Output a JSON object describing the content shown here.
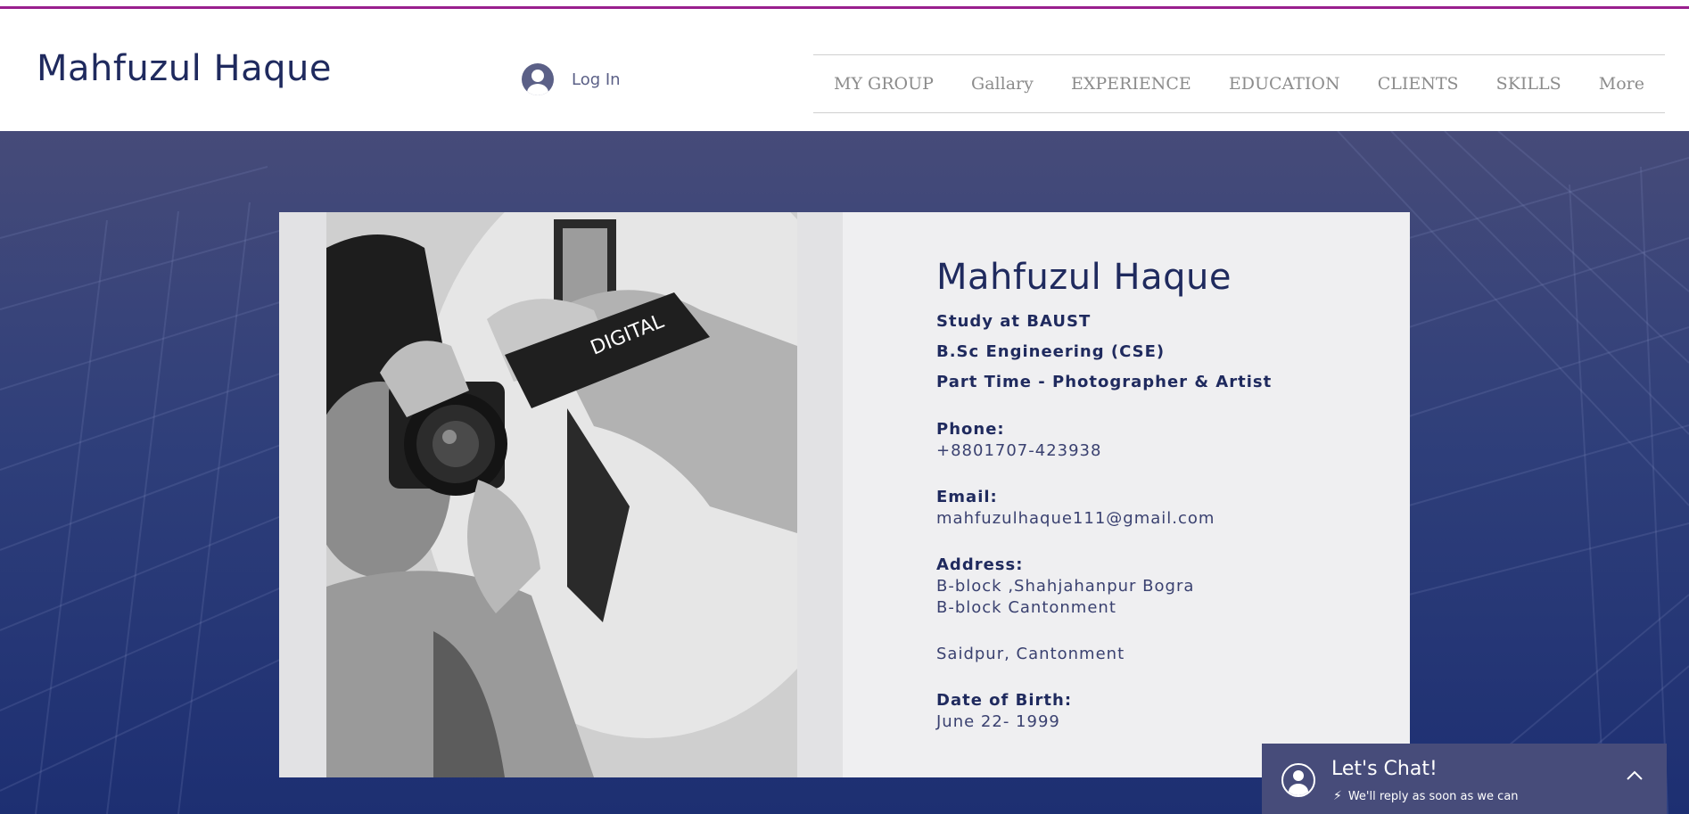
{
  "header": {
    "site_title": "Mahfuzul Haque",
    "login_label": "Log In",
    "nav": [
      "MY GROUP",
      "Gallary",
      "EXPERIENCE",
      "EDUCATION",
      "CLIENTS",
      "SKILLS",
      "More"
    ]
  },
  "profile": {
    "name": "Mahfuzul Haque",
    "study": "Study at BAUST",
    "degree": "B.Sc Engineering (CSE)",
    "part_time": "Part Time - Photographer & Artist",
    "phone_label": "Phone:",
    "phone": "+8801707-423938",
    "email_label": "Email:",
    "email": "mahfuzulhaque111@gmail.com",
    "address_label": "Address:",
    "address_line1": "B-block ,Shahjahanpur Bogra",
    "address_line2": "B-block Cantonment",
    "address_line3": "Saidpur, Cantonment",
    "dob_label": "Date of Birth:",
    "dob": "June 22- 1999"
  },
  "chat": {
    "title": "Let's Chat!",
    "subtitle": "We'll reply as soon as we can"
  },
  "colors": {
    "accent_top_line": "#9a1f8e",
    "brand_navy": "#1f2a5e",
    "chat_bg": "#474c7a"
  }
}
